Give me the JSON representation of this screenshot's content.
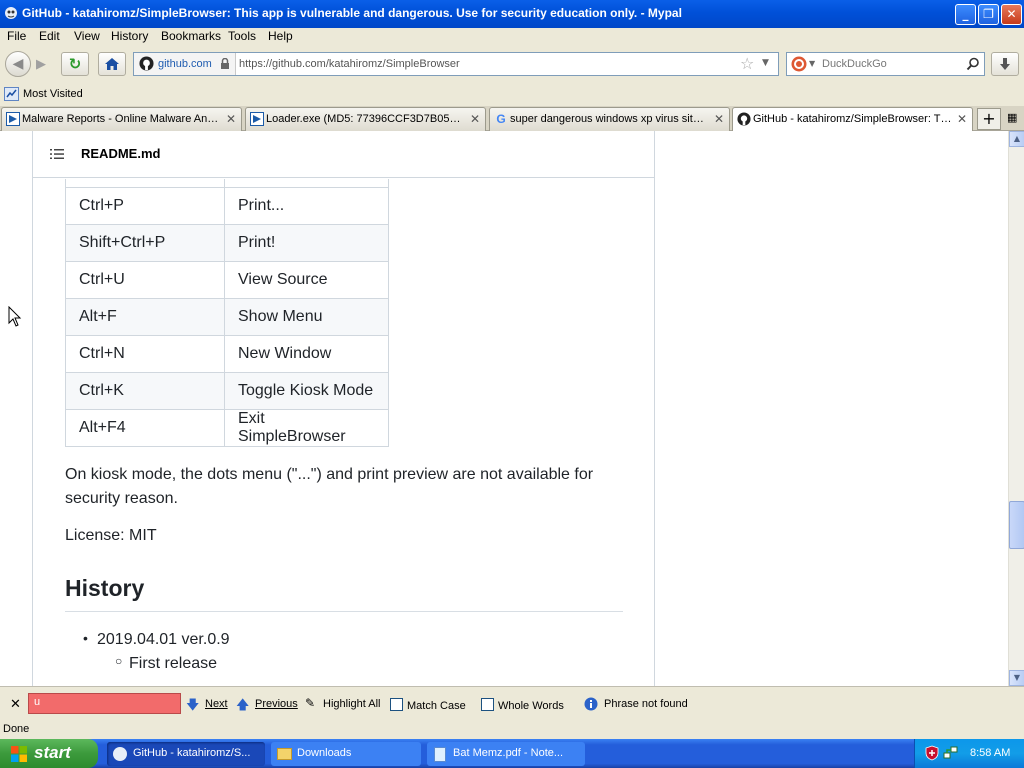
{
  "window": {
    "title": "GitHub - katahiromz/SimpleBrowser: This app is vulnerable and dangerous. Use for security education only. - Mypal"
  },
  "menu": [
    "File",
    "Edit",
    "View",
    "History",
    "Bookmarks",
    "Tools",
    "Help"
  ],
  "urlbar": {
    "identity": "github.com",
    "url": "https://github.com/katahiromz/SimpleBrowser"
  },
  "search": {
    "placeholder": "DuckDuckGo"
  },
  "bookmarks": {
    "most_visited": "Most Visited"
  },
  "tabs": [
    {
      "label": "Malware Reports - Online Malware Anal..."
    },
    {
      "label": "Loader.exe (MD5: 77396CCF3D7B05E4..."
    },
    {
      "label": "super dangerous windows xp virus site:..."
    },
    {
      "label": "GitHub - katahiromz/SimpleBrowser: Thi..."
    }
  ],
  "readme": {
    "filename": "README.md",
    "shortcuts": [
      {
        "key": "Ctrl+P",
        "action": "Print..."
      },
      {
        "key": "Shift+Ctrl+P",
        "action": "Print!"
      },
      {
        "key": "Ctrl+U",
        "action": "View Source"
      },
      {
        "key": "Alt+F",
        "action": "Show Menu"
      },
      {
        "key": "Ctrl+N",
        "action": "New Window"
      },
      {
        "key": "Ctrl+K",
        "action": "Toggle Kiosk Mode"
      },
      {
        "key": "Alt+F4",
        "action": "Exit SimpleBrowser"
      }
    ],
    "kiosk_note": "On kiosk mode, the dots menu (\"...\") and print preview are not available for security reason.",
    "license": "License: MIT",
    "history_heading": "History",
    "history_item": "2019.04.01 ver.0.9",
    "history_subitem": "First release"
  },
  "findbar": {
    "query": "u",
    "next": "Next",
    "previous": "Previous",
    "highlight_all": "Highlight All",
    "match_case": "Match Case",
    "whole_words": "Whole Words",
    "status": "Phrase not found"
  },
  "statusbar": {
    "text": "Done"
  },
  "taskbar": {
    "start": "start",
    "buttons": [
      {
        "label": "GitHub - katahiromz/S..."
      },
      {
        "label": "Downloads"
      },
      {
        "label": "Bat Memz.pdf - Note..."
      }
    ],
    "clock": "8:58 AM"
  },
  "colors": {
    "findbar_error": "#f26b6b",
    "xp_blue": "#245edb",
    "start_green": "#3c9a3c"
  }
}
